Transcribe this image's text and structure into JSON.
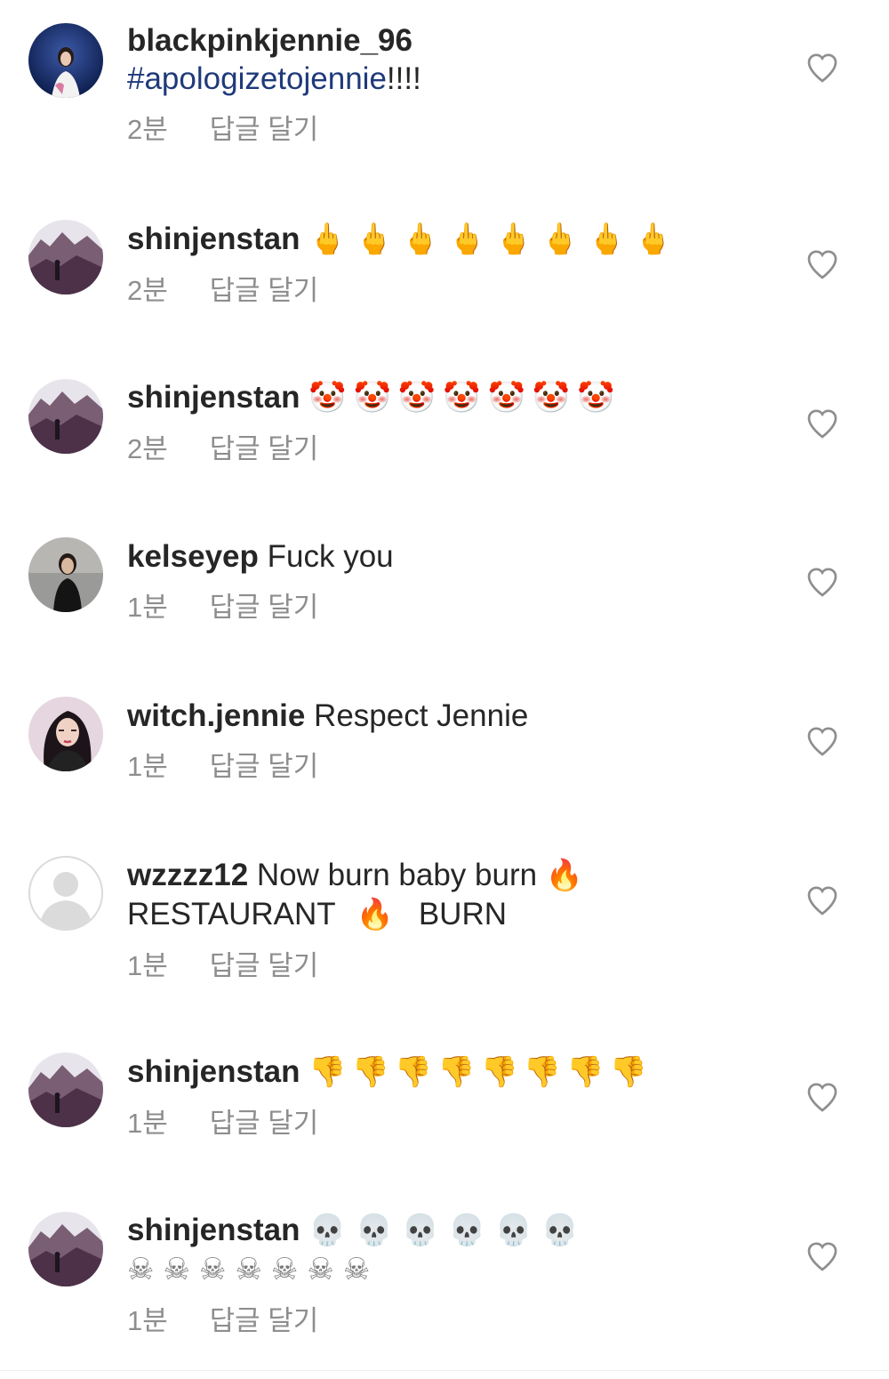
{
  "comments": [
    {
      "username": "blackpinkjennie_96",
      "text": "",
      "hashtag": "#apologizetojennie",
      "hashtag_suffix": "!!!!",
      "time": "2분",
      "reply": "답글 달기",
      "avatar": "blue-photo"
    },
    {
      "username": "shinjenstan",
      "emojis": "🖕🖕🖕🖕🖕🖕🖕🖕",
      "emoji_icon": "middle-finger-emoji",
      "time": "2분",
      "reply": "답글 달기",
      "avatar": "landscape-photo"
    },
    {
      "username": "shinjenstan",
      "emojis": "🤡🤡🤡🤡🤡🤡🤡",
      "emoji_icon": "clown-face-emoji",
      "time": "2분",
      "reply": "답글 달기",
      "avatar": "landscape-photo"
    },
    {
      "username": "kelseyep",
      "text": "Fuck you",
      "time": "1분",
      "reply": "답글 달기",
      "avatar": "dark-photo"
    },
    {
      "username": "witch.jennie",
      "text": "Respect Jennie",
      "time": "1분",
      "reply": "답글 달기",
      "avatar": "portrait-photo"
    },
    {
      "username": "wzzzz12",
      "text": "Now burn baby burn",
      "emoji_after": "🔥",
      "line2_a": "RESTAURANT",
      "line2_emoji": "🔥",
      "line2_b": "BURN",
      "emoji_icon": "fire-emoji",
      "time": "1분",
      "reply": "답글 달기",
      "avatar": "default"
    },
    {
      "username": "shinjenstan",
      "emojis": "👎👎👎👎👎👎👎👎",
      "emoji_icon": "thumbs-down-emoji",
      "time": "1분",
      "reply": "답글 달기",
      "avatar": "landscape-photo"
    },
    {
      "username": "shinjenstan",
      "emojis": "💀💀💀💀💀💀",
      "emojis_line2": "☠☠☠☠☠☠☠",
      "emoji_icon": "skull-emoji",
      "time": "1분",
      "reply": "답글 달기",
      "avatar": "landscape-photo"
    }
  ],
  "colors": {
    "text": "#262626",
    "meta": "#8e8e8e",
    "hashtag": "#1f3a7a",
    "heart": "#8e8e8e"
  }
}
